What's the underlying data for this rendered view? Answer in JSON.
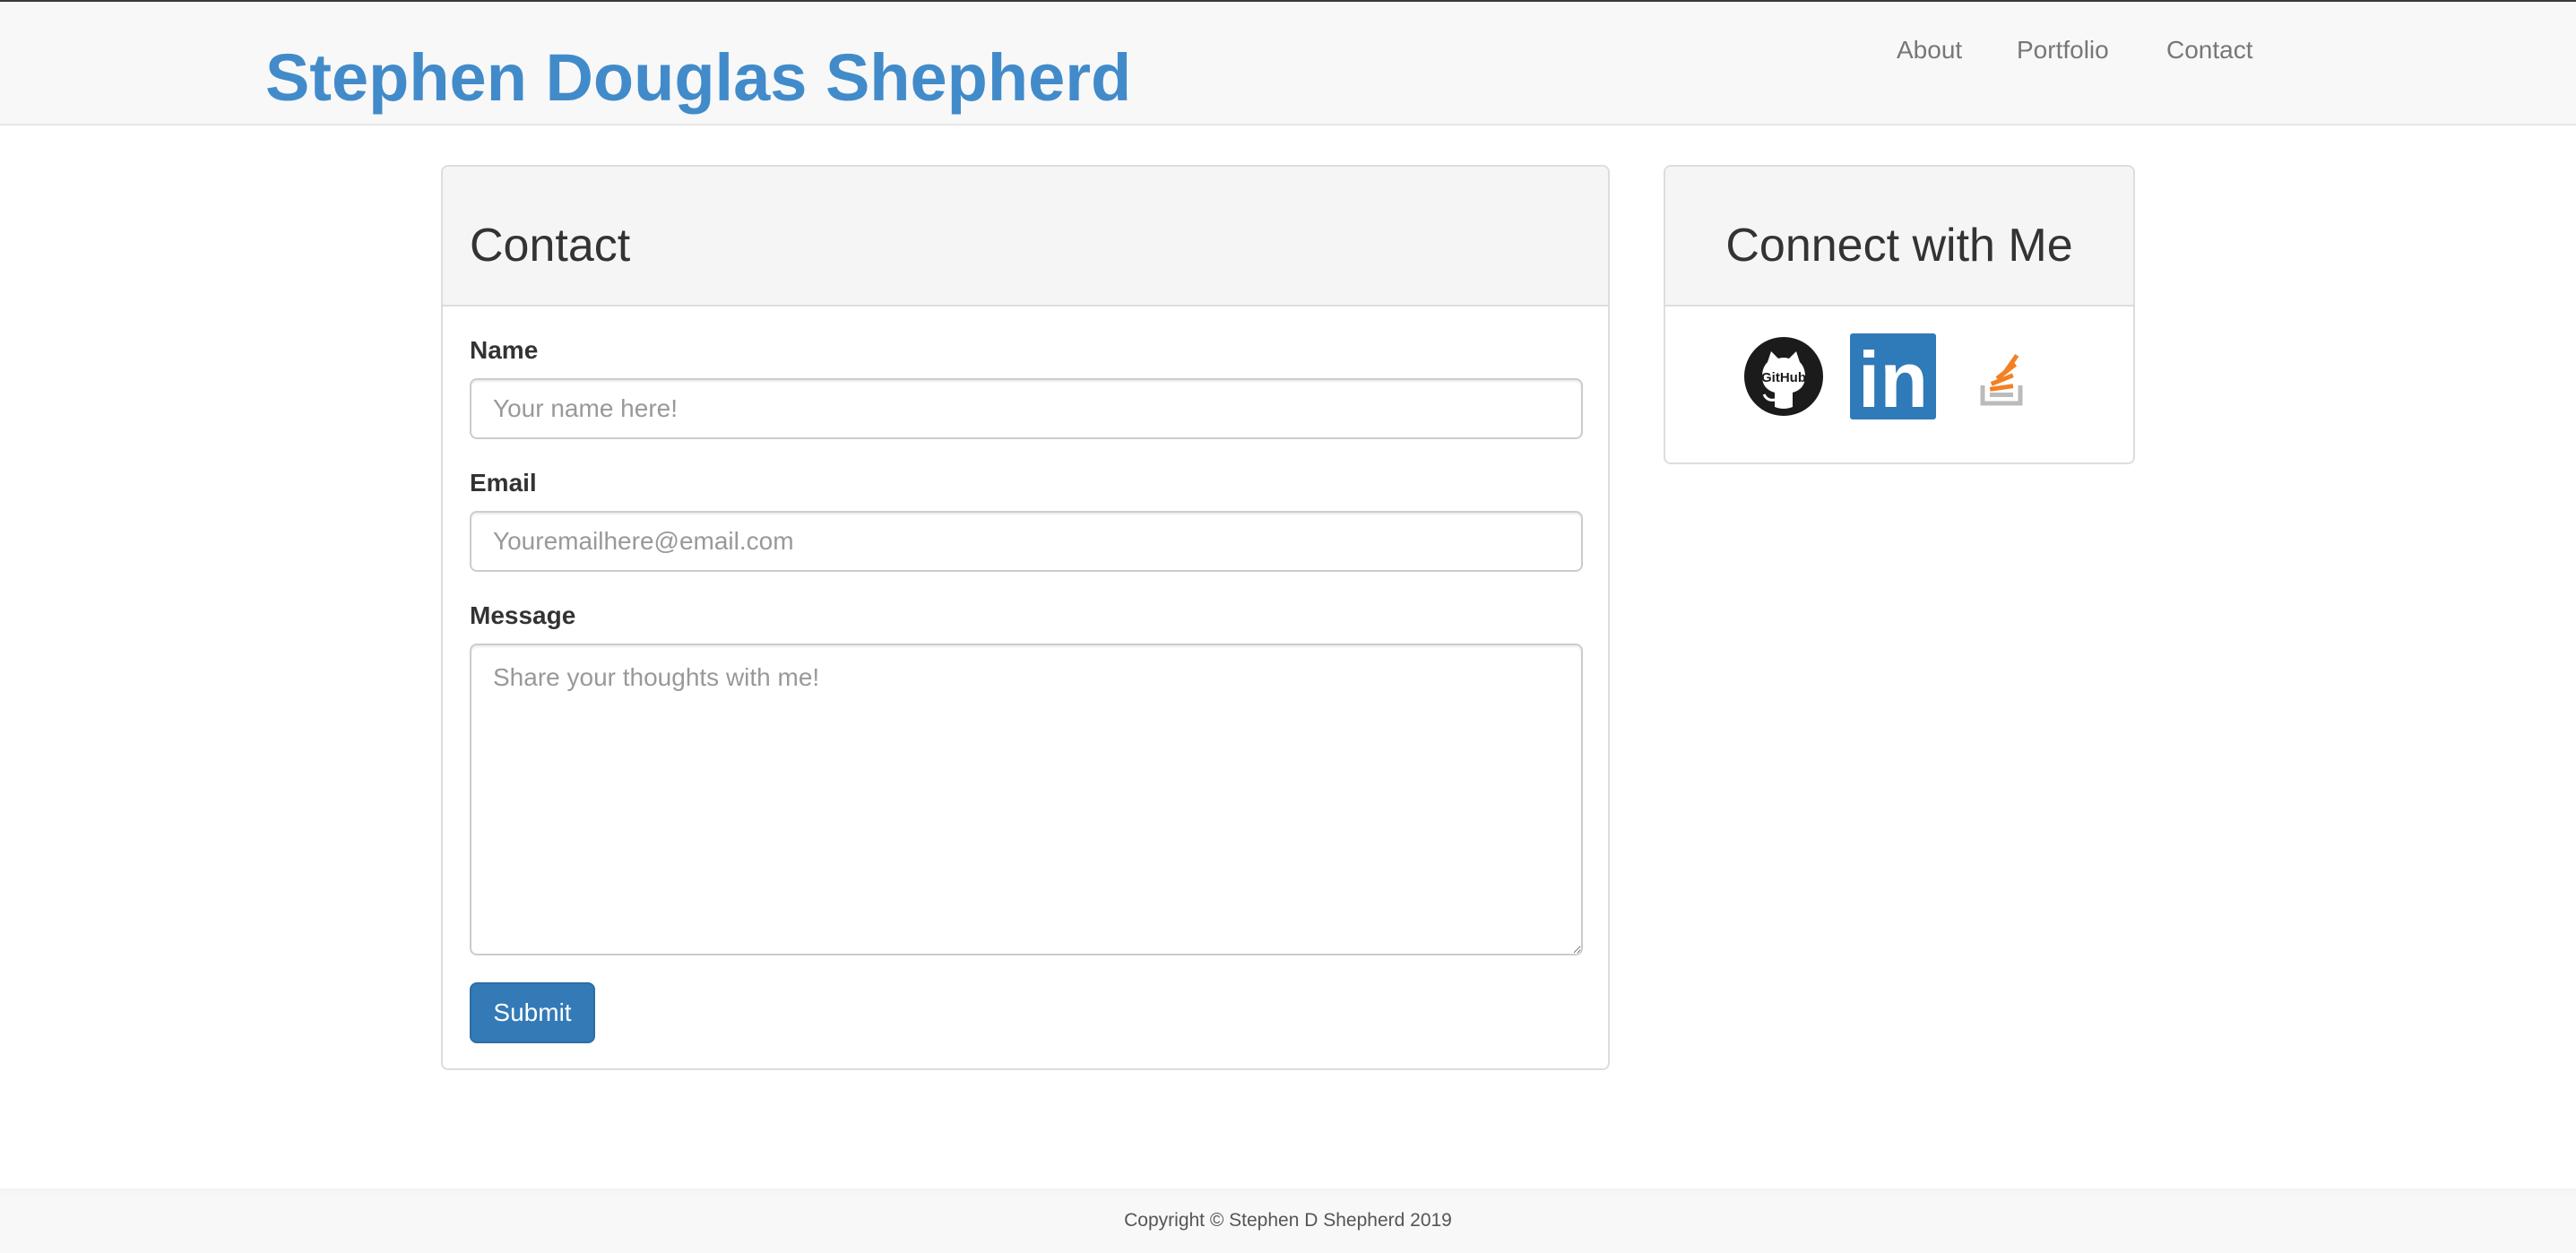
{
  "header": {
    "brand": "Stephen Douglas Shepherd",
    "nav": {
      "about": "About",
      "portfolio": "Portfolio",
      "contact": "Contact"
    }
  },
  "contact_form": {
    "title": "Contact",
    "name_label": "Name",
    "name_placeholder": "Your name here!",
    "email_label": "Email",
    "email_placeholder": "Youremailhere@email.com",
    "message_label": "Message",
    "message_placeholder": "Share your thoughts with me!",
    "submit_label": "Submit"
  },
  "connect": {
    "title": "Connect with Me",
    "links": [
      {
        "icon": "github-icon",
        "text": "GitHub"
      },
      {
        "icon": "linkedin-icon",
        "text": "in"
      },
      {
        "icon": "stackoverflow-icon"
      }
    ]
  },
  "footer": {
    "copyright": "Copyright © Stephen D Shepherd 2019"
  },
  "colors": {
    "brand": "#428bca",
    "button": "#337ab7",
    "linkedin": "#2f7ab8",
    "stackoverflow_orange": "#f48024",
    "stackoverflow_gray": "#bcbbbb",
    "github_black": "#1b1b1b"
  }
}
